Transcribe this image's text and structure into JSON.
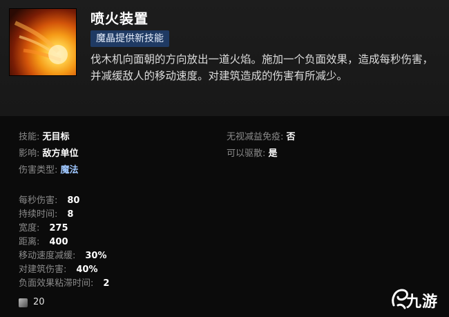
{
  "ability": {
    "name": "喷火装置",
    "badge": "魔晶提供新技能",
    "description": "伐木机向面朝的方向放出一道火焰。施加一个负面效果，造成每秒伤害，并减缓敌人的移动速度。对建筑造成的伤害有所减少。"
  },
  "properties_left": [
    {
      "label": "技能: ",
      "value": "无目标"
    },
    {
      "label": "影响: ",
      "value": "敌方单位"
    },
    {
      "label": "伤害类型: ",
      "value": "魔法"
    }
  ],
  "properties_right": [
    {
      "label": "无视减益免疫: ",
      "value": "否"
    },
    {
      "label": "可以驱散: ",
      "value": "是"
    }
  ],
  "stats": [
    {
      "label": "每秒伤害:",
      "value": "80"
    },
    {
      "label": "持续时间:",
      "value": "8"
    },
    {
      "label": "宽度:",
      "value": "275"
    },
    {
      "label": "距离:",
      "value": "400"
    },
    {
      "label": "移动速度减缓:",
      "value": "30%"
    },
    {
      "label": "对建筑伤害:",
      "value": "40%"
    },
    {
      "label": "负面效果粘滞时间:",
      "value": "2"
    }
  ],
  "mana_cost": "20",
  "watermark": {
    "text": "九游"
  },
  "colors": {
    "badge_bg": "#1f3a63",
    "magic_value": "#9fc7ff",
    "label_gray": "#8a8a8a"
  }
}
